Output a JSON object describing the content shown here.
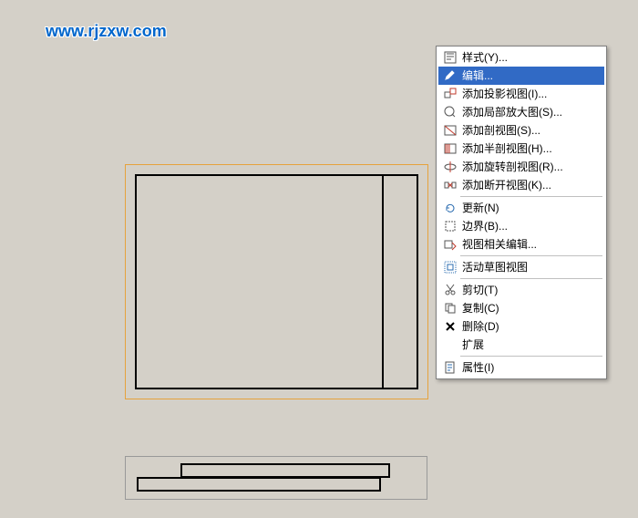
{
  "watermark": "www.rjzxw.com",
  "menu": {
    "items": [
      {
        "icon": "style-icon",
        "label": "样式(Y)..."
      },
      {
        "icon": "edit-icon",
        "label": "编辑...",
        "highlighted": true
      },
      {
        "icon": "projection-icon",
        "label": "添加投影视图(I)..."
      },
      {
        "icon": "detail-icon",
        "label": "添加局部放大图(S)..."
      },
      {
        "icon": "section-icon",
        "label": "添加剖视图(S)..."
      },
      {
        "icon": "half-section-icon",
        "label": "添加半剖视图(H)..."
      },
      {
        "icon": "revolve-icon",
        "label": "添加旋转剖视图(R)..."
      },
      {
        "icon": "break-icon",
        "label": "添加断开视图(K)..."
      },
      {
        "sep": true
      },
      {
        "icon": "refresh-icon",
        "label": "更新(N)"
      },
      {
        "icon": "boundary-icon",
        "label": "边界(B)..."
      },
      {
        "icon": "view-edit-icon",
        "label": "视图相关编辑..."
      },
      {
        "sep": true
      },
      {
        "icon": "sketch-view-icon",
        "label": "活动草图视图"
      },
      {
        "sep": true
      },
      {
        "icon": "cut-icon",
        "label": "剪切(T)"
      },
      {
        "icon": "copy-icon",
        "label": "复制(C)"
      },
      {
        "icon": "delete-icon",
        "label": "删除(D)"
      },
      {
        "icon": "expand-icon",
        "label": "扩展"
      },
      {
        "sep": true
      },
      {
        "icon": "properties-icon",
        "label": "属性(I)"
      }
    ]
  }
}
